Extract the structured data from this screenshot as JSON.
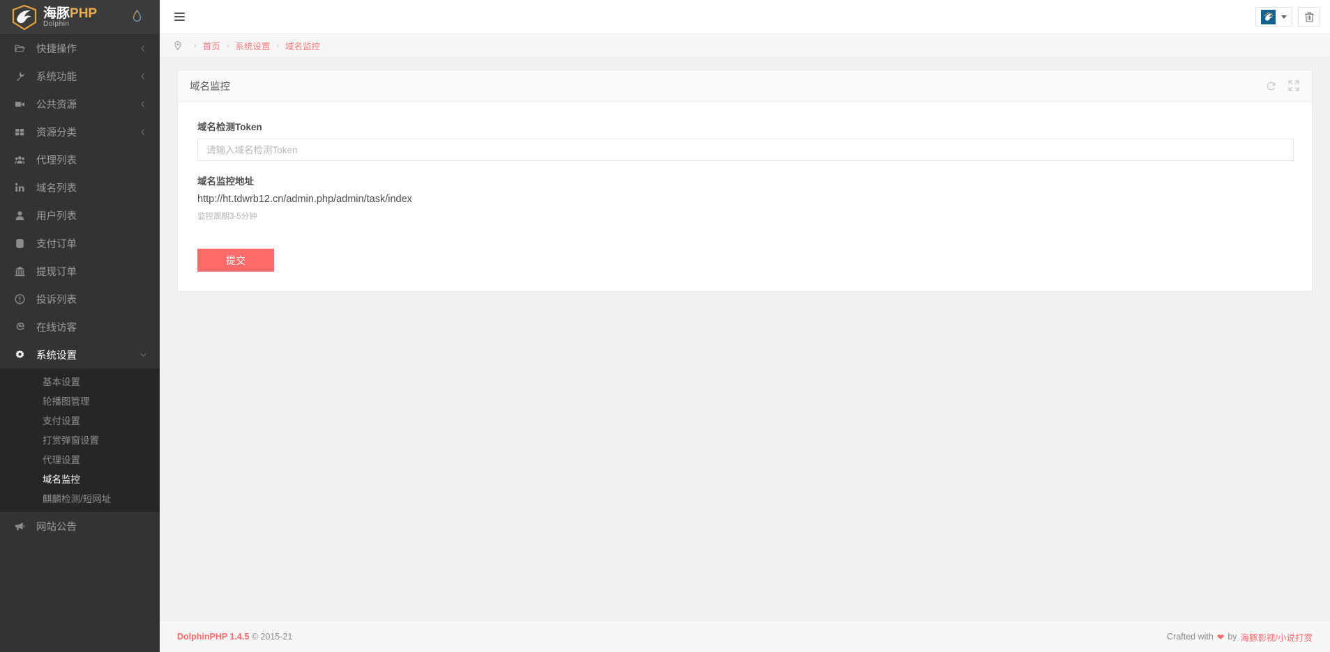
{
  "brand": {
    "cn": "海豚",
    "php": "PHP",
    "sub": "Dolphin",
    "logo_icon": "dolphin-logo-icon",
    "drop_icon": "water-drop-icon"
  },
  "sidebar": {
    "items": [
      {
        "label": "快捷操作",
        "icon": "folder-open-icon",
        "caret": "chevron-left-icon",
        "active": false
      },
      {
        "label": "系统功能",
        "icon": "wrench-icon",
        "caret": "chevron-left-icon",
        "active": false
      },
      {
        "label": "公共资源",
        "icon": "video-camera-icon",
        "caret": "chevron-left-icon",
        "active": false
      },
      {
        "label": "资源分类",
        "icon": "grid-icon",
        "caret": "chevron-left-icon",
        "active": false
      },
      {
        "label": "代理列表",
        "icon": "users-icon",
        "caret": "",
        "active": false
      },
      {
        "label": "域名列表",
        "icon": "linkedin-in-icon",
        "caret": "",
        "active": false
      },
      {
        "label": "用户列表",
        "icon": "user-icon",
        "caret": "",
        "active": false
      },
      {
        "label": "支付订单",
        "icon": "database-icon",
        "caret": "",
        "active": false
      },
      {
        "label": "提现订单",
        "icon": "bank-icon",
        "caret": "",
        "active": false
      },
      {
        "label": "投诉列表",
        "icon": "exclamation-circle-icon",
        "caret": "",
        "active": false
      },
      {
        "label": "在线访客",
        "icon": "edge-browser-icon",
        "caret": "",
        "active": false
      },
      {
        "label": "系统设置",
        "icon": "gear-icon",
        "caret": "chevron-down-icon",
        "active": true
      }
    ],
    "submenu": [
      {
        "label": "基本设置",
        "active": false
      },
      {
        "label": "轮播图管理",
        "active": false
      },
      {
        "label": "支付设置",
        "active": false
      },
      {
        "label": "打赏弹窗设置",
        "active": false
      },
      {
        "label": "代理设置",
        "active": false
      },
      {
        "label": "域名监控",
        "active": true
      },
      {
        "label": "麒麟检测/短网址",
        "active": false
      }
    ],
    "bottom_items": [
      {
        "label": "网站公告",
        "icon": "bullhorn-icon",
        "caret": "",
        "active": false
      }
    ]
  },
  "topbar": {
    "menu_toggle_icon": "hamburger-icon",
    "avatar_icon": "dolphin-avatar-icon",
    "avatar_caret_icon": "caret-down-icon",
    "trash_icon": "trash-icon"
  },
  "breadcrumb": {
    "pin_icon": "map-marker-icon",
    "items": [
      {
        "label": "首页",
        "link": true
      },
      {
        "label": "系统设置",
        "link": true
      },
      {
        "label": "域名监控",
        "link": true
      }
    ],
    "separator": "›"
  },
  "card": {
    "title": "域名监控",
    "refresh_icon": "refresh-icon",
    "fullscreen_icon": "expand-icon"
  },
  "form": {
    "token_label": "域名检测Token",
    "token_value": "",
    "token_placeholder": "请输入域名检测Token",
    "url_label": "域名监控地址",
    "url_value": "http://ht.tdwrb12.cn/admin.php/admin/task/index",
    "help_text": "监控周期3-5分钟",
    "submit_label": "提交"
  },
  "footer": {
    "brand": "DolphinPHP 1.4.5",
    "copyright": "© 2015-21",
    "crafted_prefix": "Crafted with",
    "heart": "❤",
    "crafted_by": "by",
    "author": "海豚影视/小说打赏"
  },
  "colors": {
    "accent": "#fc6a6a",
    "sidebar": "#333333",
    "submenu": "#262626",
    "brand_orange": "#f0ad4e",
    "avatar_blue": "#12618e"
  }
}
